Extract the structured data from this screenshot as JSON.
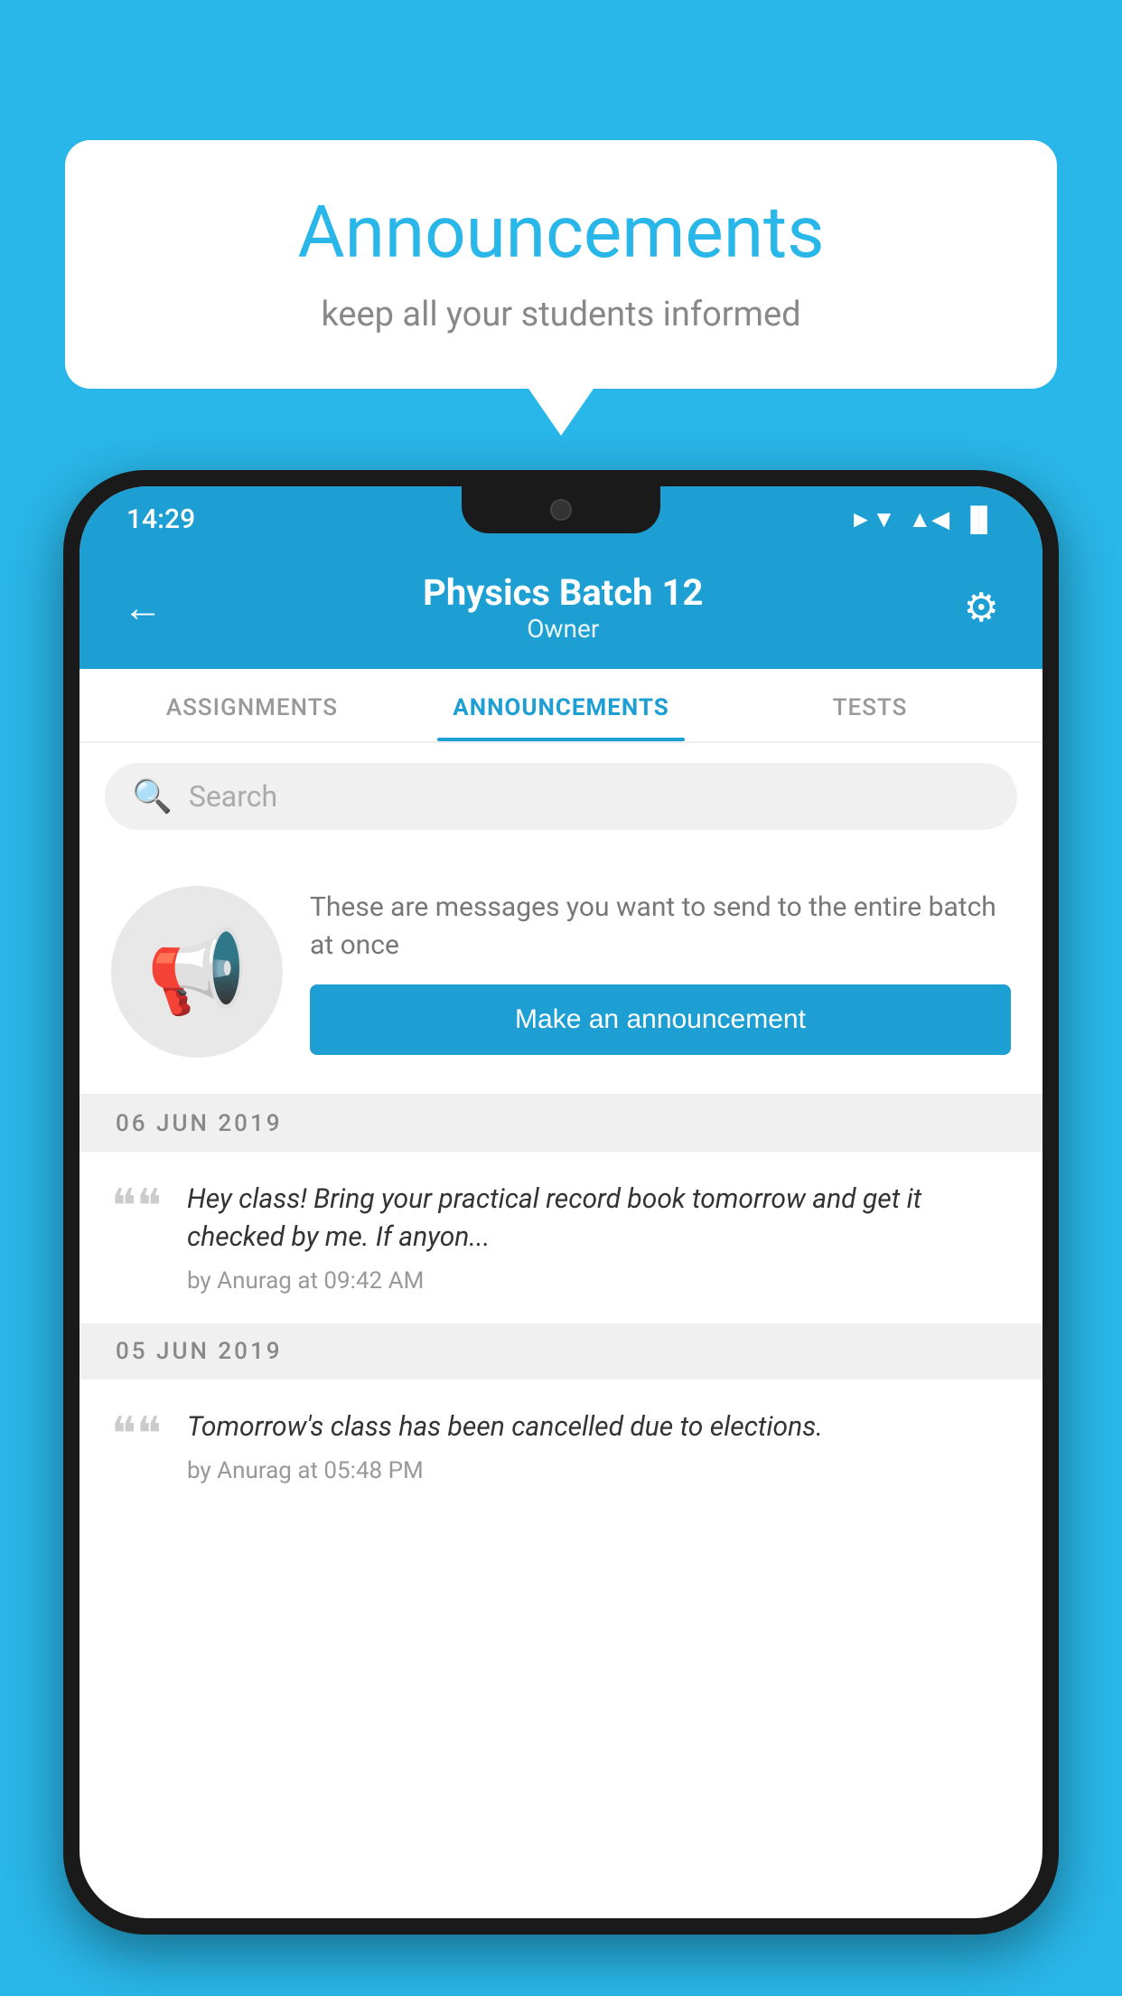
{
  "background_color": "#29b6e8",
  "speech_bubble": {
    "title": "Announcements",
    "subtitle": "keep all your students informed"
  },
  "phone": {
    "status_bar": {
      "time": "14:29",
      "wifi": "▼",
      "signal": "▲",
      "battery": "▐"
    },
    "header": {
      "title": "Physics Batch 12",
      "subtitle": "Owner",
      "back_label": "←",
      "settings_label": "⚙"
    },
    "tabs": [
      {
        "label": "ASSIGNMENTS",
        "active": false
      },
      {
        "label": "ANNOUNCEMENTS",
        "active": true
      },
      {
        "label": "TESTS",
        "active": false
      }
    ],
    "search": {
      "placeholder": "Search"
    },
    "announcement_prompt": {
      "description": "These are messages you want to send to the entire batch at once",
      "button_label": "Make an announcement"
    },
    "announcements": [
      {
        "date": "06  JUN  2019",
        "text": "Hey class! Bring your practical record book tomorrow and get it checked by me. If anyon...",
        "meta": "by Anurag at 09:42 AM"
      },
      {
        "date": "05  JUN  2019",
        "text": "Tomorrow's class has been cancelled due to elections.",
        "meta": "by Anurag at 05:48 PM"
      }
    ]
  }
}
